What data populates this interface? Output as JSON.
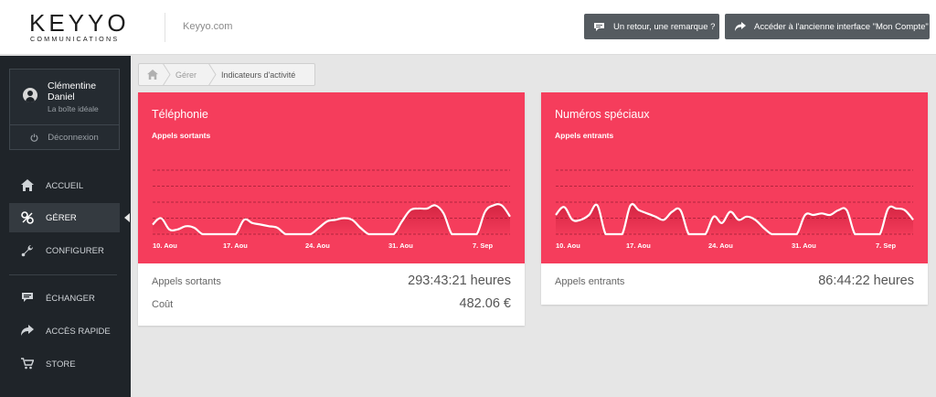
{
  "header": {
    "logo_text": "KEYYO",
    "logo_subtext": "COMMUNICATIONS",
    "site_link": "Keyyo.com",
    "feedback_button": "Un retour, une remarque ?",
    "legacy_button": "Accéder à l'ancienne interface \"Mon Compte\""
  },
  "user": {
    "name": "Clémentine Daniel",
    "company": "La boîte idéale",
    "logout": "Déconnexion"
  },
  "nav": {
    "items": [
      {
        "label": "ACCUEIL",
        "icon": "home-icon"
      },
      {
        "label": "GÉRER",
        "icon": "settings-icon",
        "active": true
      },
      {
        "label": "CONFIGURER",
        "icon": "wrench-icon"
      },
      {
        "label": "ÉCHANGER",
        "icon": "chat-icon"
      },
      {
        "label": "ACCÈS RAPIDE",
        "icon": "share-icon"
      },
      {
        "label": "STORE",
        "icon": "cart-icon"
      }
    ]
  },
  "breadcrumb": {
    "items": [
      "Gérer",
      "Indicateurs d'activité"
    ]
  },
  "colors": {
    "accent": "#f53d5c",
    "sidebar": "#1f2429",
    "button": "#555b60"
  },
  "cards": {
    "telephonie": {
      "title": "Téléphonie",
      "subtitle": "Appels sortants",
      "stats": [
        {
          "label": "Appels sortants",
          "value": "293:43:21 heures"
        },
        {
          "label": "Coût",
          "value": "482.06 €"
        }
      ]
    },
    "numeros": {
      "title": "Numéros spéciaux",
      "subtitle": "Appels entrants",
      "stats": [
        {
          "label": "Appels entrants",
          "value": "86:44:22 heures"
        }
      ]
    }
  },
  "chart_data": [
    {
      "type": "area",
      "title": "Téléphonie",
      "subtitle": "Appels sortants",
      "x_ticks": [
        "10. Aou",
        "17. Aou",
        "24. Aou",
        "31. Aou",
        "7. Sep"
      ],
      "ylim": [
        0,
        4
      ],
      "grid": true,
      "values": [
        0.6,
        1.0,
        0.3,
        0.3,
        0.5,
        0.4,
        0,
        0,
        0,
        0,
        0,
        0.9,
        0.7,
        0.6,
        0.5,
        0.4,
        0,
        0,
        0,
        0,
        0.4,
        0.8,
        0.9,
        1.0,
        0.9,
        0.4,
        0,
        0,
        0,
        0,
        0.8,
        1.5,
        1.6,
        1.6,
        1.8,
        1.3,
        0,
        0,
        0,
        0,
        1.4,
        1.8,
        1.8,
        1.1
      ]
    },
    {
      "type": "area",
      "title": "Numéros spéciaux",
      "subtitle": "Appels entrants",
      "x_ticks": [
        "10. Aou",
        "17. Aou",
        "24. Aou",
        "31. Aou",
        "7. Sep"
      ],
      "ylim": [
        0,
        4
      ],
      "grid": true,
      "values": [
        1.2,
        1.7,
        0.9,
        0.9,
        1.2,
        1.8,
        0,
        0,
        0,
        1.8,
        1.5,
        1.3,
        1.1,
        0.9,
        1.4,
        1.5,
        0,
        0,
        0,
        1.1,
        0.7,
        1.4,
        0.9,
        1.1,
        0.9,
        0.4,
        0,
        0,
        0,
        0,
        1.2,
        1.2,
        1.3,
        1.2,
        1.5,
        1.5,
        0,
        0,
        0,
        0,
        1.6,
        1.6,
        1.5,
        0.9
      ]
    }
  ]
}
